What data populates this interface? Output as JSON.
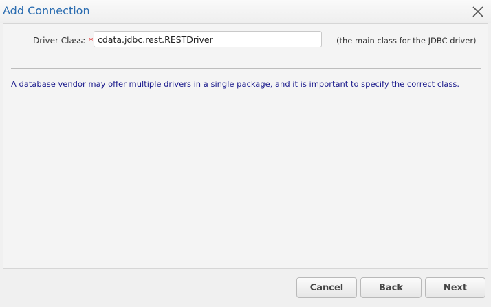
{
  "dialog": {
    "title": "Add Connection",
    "close_icon": "close-icon"
  },
  "form": {
    "driver_class": {
      "label": "Driver Class:",
      "required_mark": "*",
      "value": "cdata.jdbc.rest.RESTDriver",
      "hint": "(the main class for the JDBC driver)"
    },
    "info": "A database vendor may offer multiple drivers in a single package, and it is important to specify the correct class."
  },
  "footer": {
    "cancel_label": "Cancel",
    "back_label": "Back",
    "next_label": "Next"
  },
  "colors": {
    "title": "#2a6cb0",
    "info_text": "#1a1a8c",
    "required": "#e02020"
  }
}
